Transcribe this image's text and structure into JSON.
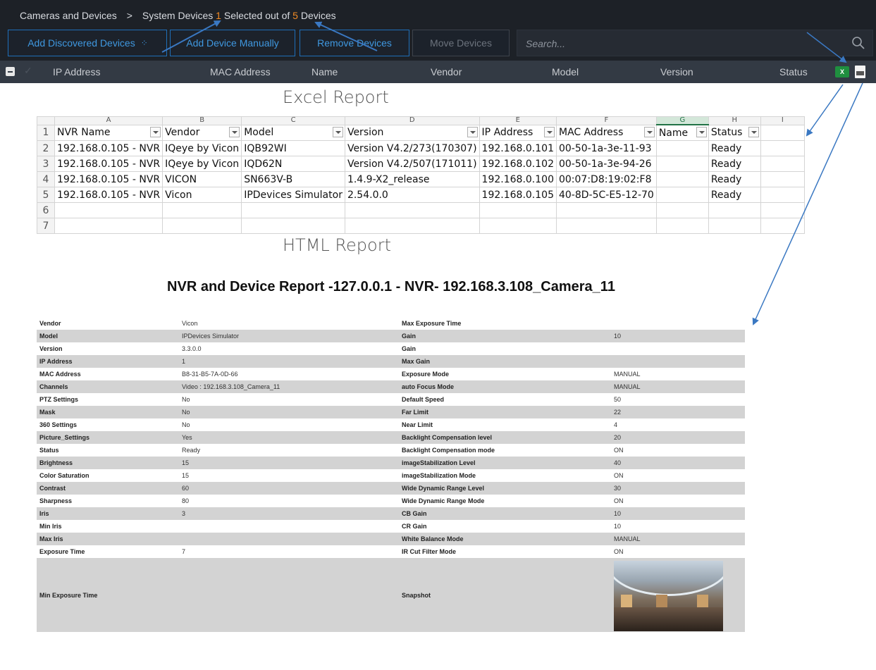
{
  "app": {
    "breadcrumb": {
      "root": "Cameras and Devices",
      "sep": ">",
      "section": "System Devices",
      "selected_count": "1",
      "selected_mid": "Selected out of",
      "total_count": "5",
      "total_suffix": "Devices"
    },
    "toolbar": {
      "add_discovered": "Add Discovered Devices",
      "add_manual": "Add Device Manually",
      "remove": "Remove Devices",
      "move": "Move Devices"
    },
    "search": {
      "placeholder": "Search..."
    },
    "columns": [
      "IP Address",
      "MAC Address",
      "Name",
      "Vendor",
      "Model",
      "Version",
      "Status"
    ],
    "export_icons": {
      "excel": "X",
      "html": "html-file-icon"
    },
    "colors": {
      "accent": "#3f98e0",
      "highlight": "#f08a24",
      "bar": "#1d2127"
    }
  },
  "excel": {
    "caption": "Excel Report",
    "col_letters": [
      "A",
      "B",
      "C",
      "D",
      "E",
      "F",
      "G",
      "H",
      "I"
    ],
    "headers": [
      "NVR Name",
      "Vendor",
      "Model",
      "Version",
      "IP Address",
      "MAC Address",
      "Name",
      "Status"
    ],
    "rows": [
      [
        "192.168.0.105 - NVR",
        "IQeye by Vicon",
        "IQB92WI",
        "Version V4.2/273(170307)",
        "192.168.0.101",
        "00-50-1a-3e-11-93",
        "",
        "Ready"
      ],
      [
        "192.168.0.105 - NVR",
        "IQeye by Vicon",
        "IQD62N",
        "Version V4.2/507(171011)",
        "192.168.0.102",
        "00-50-1a-3e-94-26",
        "",
        "Ready"
      ],
      [
        "192.168.0.105 - NVR",
        "VICON",
        "SN663V-B",
        "1.4.9-X2_release",
        "192.168.0.100",
        "00:07:D8:19:02:F8",
        "",
        "Ready"
      ],
      [
        "192.168.0.105 - NVR",
        "Vicon",
        "IPDevices Simulator",
        "2.54.0.0",
        "192.168.0.105",
        "40-8D-5C-E5-12-70",
        "",
        "Ready"
      ]
    ],
    "row_numbers": [
      "1",
      "2",
      "3",
      "4",
      "5",
      "6",
      "7"
    ]
  },
  "html_report": {
    "caption": "HTML Report",
    "title": "NVR and Device Report -127.0.0.1 - NVR- 192.168.3.108_Camera_11",
    "rows": [
      [
        "Vendor",
        "Vicon",
        "Max Exposure Time",
        ""
      ],
      [
        "Model",
        "IPDevices Simulator",
        "Gain",
        "10"
      ],
      [
        "Version",
        "3.3.0.0",
        "Gain",
        ""
      ],
      [
        "IP Address",
        "1",
        "Max Gain",
        ""
      ],
      [
        "MAC Address",
        "B8-31-B5-7A-0D-66",
        "Exposure Mode",
        "MANUAL"
      ],
      [
        "Channels",
        "Video : 192.168.3.108_Camera_11",
        "auto Focus Mode",
        "MANUAL"
      ],
      [
        "PTZ Settings",
        "No",
        "Default Speed",
        "50"
      ],
      [
        "Mask",
        "No",
        "Far Limit",
        "22"
      ],
      [
        "360 Settings",
        "No",
        "Near Limit",
        "4"
      ],
      [
        "Picture_Settings",
        "Yes",
        "Backlight Compensation level",
        "20"
      ],
      [
        "Status",
        "Ready",
        "Backlight Compensation mode",
        "ON"
      ],
      [
        "Brightness",
        "15",
        "imageStabilization Level",
        "40"
      ],
      [
        "Color Saturation",
        "15",
        "imageStabilization Mode",
        "ON"
      ],
      [
        "Contrast",
        "60",
        "Wide Dynamic Range Level",
        "30"
      ],
      [
        "Sharpness",
        "80",
        "Wide Dynamic Range Mode",
        "ON"
      ],
      [
        "Iris",
        "3",
        "CB Gain",
        "10"
      ],
      [
        "Min Iris",
        "",
        "CR Gain",
        "10"
      ],
      [
        "Max Iris",
        "",
        "White Balance Mode",
        "MANUAL"
      ],
      [
        "Exposure Time",
        "7",
        "IR Cut Filter Mode",
        "ON"
      ]
    ],
    "last_row": {
      "label": "Min Exposure Time",
      "value": "",
      "label2": "Snapshot"
    }
  }
}
